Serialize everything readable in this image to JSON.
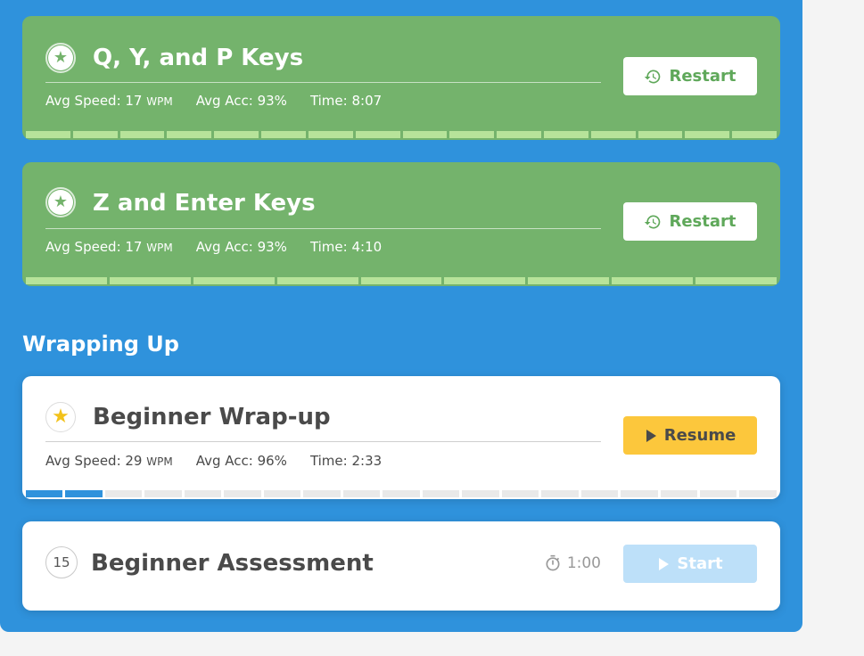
{
  "lessons": [
    {
      "title": "Q, Y, and P Keys",
      "stats": {
        "speed_label": "Avg Speed: 17",
        "speed_unit": "WPM",
        "acc": "Avg Acc: 93%",
        "time": "Time: 8:07"
      },
      "button": "Restart",
      "segments": 16
    },
    {
      "title": "Z and Enter Keys",
      "stats": {
        "speed_label": "Avg Speed: 17",
        "speed_unit": "WPM",
        "acc": "Avg Acc: 93%",
        "time": "Time: 4:10"
      },
      "button": "Restart",
      "segments": 9
    }
  ],
  "section": {
    "title": "Wrapping Up"
  },
  "wrapup": {
    "title": "Beginner Wrap-up",
    "stats": {
      "speed_label": "Avg Speed: 29",
      "speed_unit": "WPM",
      "acc": "Avg Acc: 96%",
      "time": "Time: 2:33"
    },
    "button": "Resume",
    "segments_total": 19,
    "segments_done": 2
  },
  "assessment": {
    "number": "15",
    "title": "Beginner Assessment",
    "timer": "1:00",
    "button": "Start"
  },
  "colors": {
    "accent": "#2f92dc",
    "complete": "#74b36c",
    "resume": "#fcc73c"
  }
}
